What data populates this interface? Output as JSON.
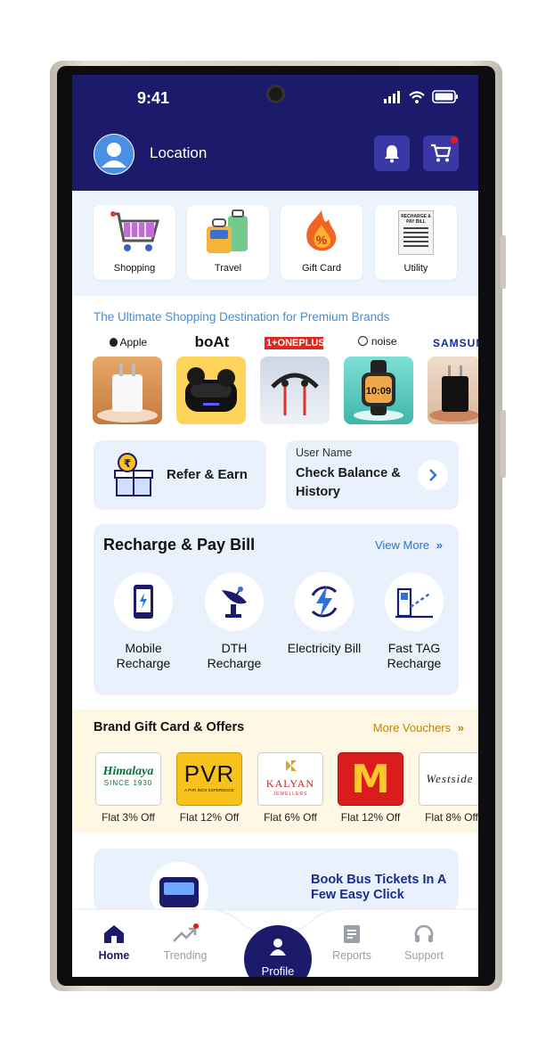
{
  "status": {
    "time": "9:41"
  },
  "header": {
    "location_label": "Location"
  },
  "categories": [
    {
      "label": "Shopping",
      "icon": "shopping-cart-icon"
    },
    {
      "label": "Travel",
      "icon": "luggage-icon"
    },
    {
      "label": "Gift Card",
      "icon": "gift-card-fire-icon"
    },
    {
      "label": "Utility",
      "icon": "bill-receipt-icon"
    }
  ],
  "bill_receipt_text": "RECHARGE & PAY BILL",
  "tagline": "The Ultimate Shopping Destination for Premium Brands",
  "brands": [
    {
      "name": "Apple"
    },
    {
      "name": "boAt"
    },
    {
      "name": "1+ONEPLUS"
    },
    {
      "name": "noise"
    },
    {
      "name": "SAMSUNG"
    }
  ],
  "refer": {
    "label": "Refer & Earn"
  },
  "balance": {
    "user": "User Name",
    "title": "Check Balance & History"
  },
  "recharge": {
    "title": "Recharge & Pay Bill",
    "view_more": "View More",
    "items": [
      {
        "label": "Mobile Recharge",
        "icon": "mobile-phone-icon"
      },
      {
        "label": "DTH Recharge",
        "icon": "satellite-dish-icon"
      },
      {
        "label": "Electricity Bill",
        "icon": "lightning-icon"
      },
      {
        "label": "Fast TAG Recharge",
        "icon": "toll-booth-icon"
      }
    ]
  },
  "gifts": {
    "title": "Brand Gift Card & Offers",
    "more": "More Vouchers",
    "items": [
      {
        "brand": "Himalaya",
        "sub": "SINCE 1930",
        "offer": "Flat 3% Off"
      },
      {
        "brand": "PVR",
        "sub": "A PVR INOX EXPERIENCE",
        "offer": "Flat 12% Off"
      },
      {
        "brand": "KALYAN",
        "sub": "JEWELLERS",
        "offer": "Flat 6% Off"
      },
      {
        "brand": "M",
        "sub": "",
        "offer": "Flat 12% Off"
      },
      {
        "brand": "Westside",
        "sub": "",
        "offer": "Flat 8% Off"
      }
    ]
  },
  "bus": {
    "text": "Book Bus Tickets In A Few Easy Click"
  },
  "nav": {
    "home": "Home",
    "trending": "Trending",
    "profile": "Profile",
    "reports": "Reports",
    "support": "Support"
  },
  "colors": {
    "primary": "#1c1a6b",
    "accent_blue": "#2f72d6",
    "link_gold": "#b8860b"
  }
}
